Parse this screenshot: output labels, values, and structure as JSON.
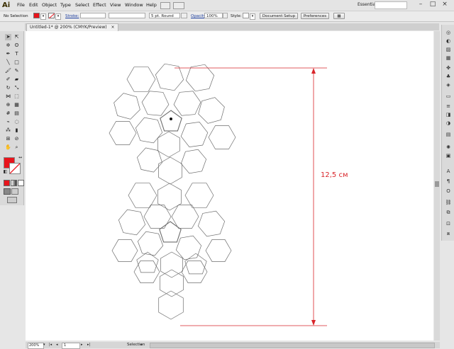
{
  "app": {
    "logo": "Ai"
  },
  "menu": [
    "File",
    "Edit",
    "Object",
    "Type",
    "Select",
    "Effect",
    "View",
    "Window",
    "Help"
  ],
  "workspace": "Essentials",
  "window_controls": {
    "minimize": "–",
    "maximize": "□",
    "close": "×"
  },
  "control_bar": {
    "selection": "No Selection",
    "fill_color": "#e8141c",
    "stroke_label": "Stroke:",
    "brush": "5 pt. Round",
    "opacity_label": "Opacity:",
    "opacity_value": "100%",
    "style_label": "Style:",
    "document_setup": "Document Setup",
    "preferences": "Preferences"
  },
  "document": {
    "tab_title": "Untitled-1* @ 200% (CMYK/Preview)",
    "close_icon": "×"
  },
  "artwork": {
    "dimension_label": "12,5 см",
    "dimension_color": "#d9252a"
  },
  "status_bar": {
    "zoom": "200%",
    "artboard": "1",
    "tool": "Selection"
  },
  "toolbar": {
    "fill": "#e8141c",
    "stroke_none_color": "#e8141c"
  }
}
